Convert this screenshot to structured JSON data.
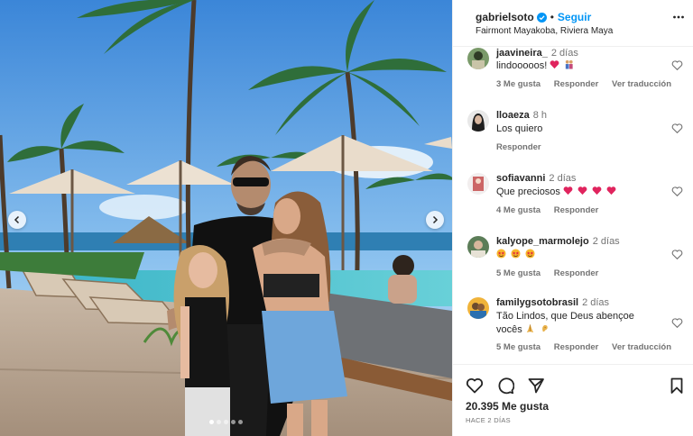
{
  "post": {
    "username": "gabrielsoto",
    "separator": "•",
    "follow_label": "Seguir",
    "location": "Fairmont Mayakoba, Riviera Maya",
    "likes": "20.395 Me gusta",
    "posted_ago": "HACE 2 DÍAS",
    "carousel": {
      "slides": 5,
      "active_slide": 1
    }
  },
  "comments": [
    {
      "user": "jaavineira_",
      "time": "2 días",
      "text": "lindooooos!",
      "emojis": [
        "red-heart",
        "couple"
      ],
      "likes": "3 Me gusta",
      "reply": "Responder",
      "translate": "Ver traducción"
    },
    {
      "user": "lloaeza",
      "time": "8 h",
      "text": "Los quiero",
      "emojis": [],
      "likes": "",
      "reply": "Responder",
      "translate": ""
    },
    {
      "user": "sofiavanni",
      "time": "2 días",
      "text": "Que preciosos",
      "emojis": [
        "red-heart",
        "red-heart",
        "red-heart",
        "red-heart"
      ],
      "likes": "4 Me gusta",
      "reply": "Responder",
      "translate": ""
    },
    {
      "user": "kalyope_marmolejo",
      "time": "2 días",
      "text": "",
      "emojis": [
        "star-struck",
        "star-struck",
        "star-struck"
      ],
      "likes": "5 Me gusta",
      "reply": "Responder",
      "translate": ""
    },
    {
      "user": "familygsotobrasil",
      "time": "2 días",
      "text_line1": "Tão Lindos, que Deus abençoe",
      "text_line2": "vocês",
      "emojis": [
        "praying-hands",
        "ear"
      ],
      "likes": "5 Me gusta",
      "reply": "Responder",
      "translate": "Ver traducción"
    }
  ],
  "colors": {
    "follow": "#0095f6",
    "secondary_text": "#737373",
    "heart_emoji": "#e0245e",
    "verified": "#0095f6"
  }
}
